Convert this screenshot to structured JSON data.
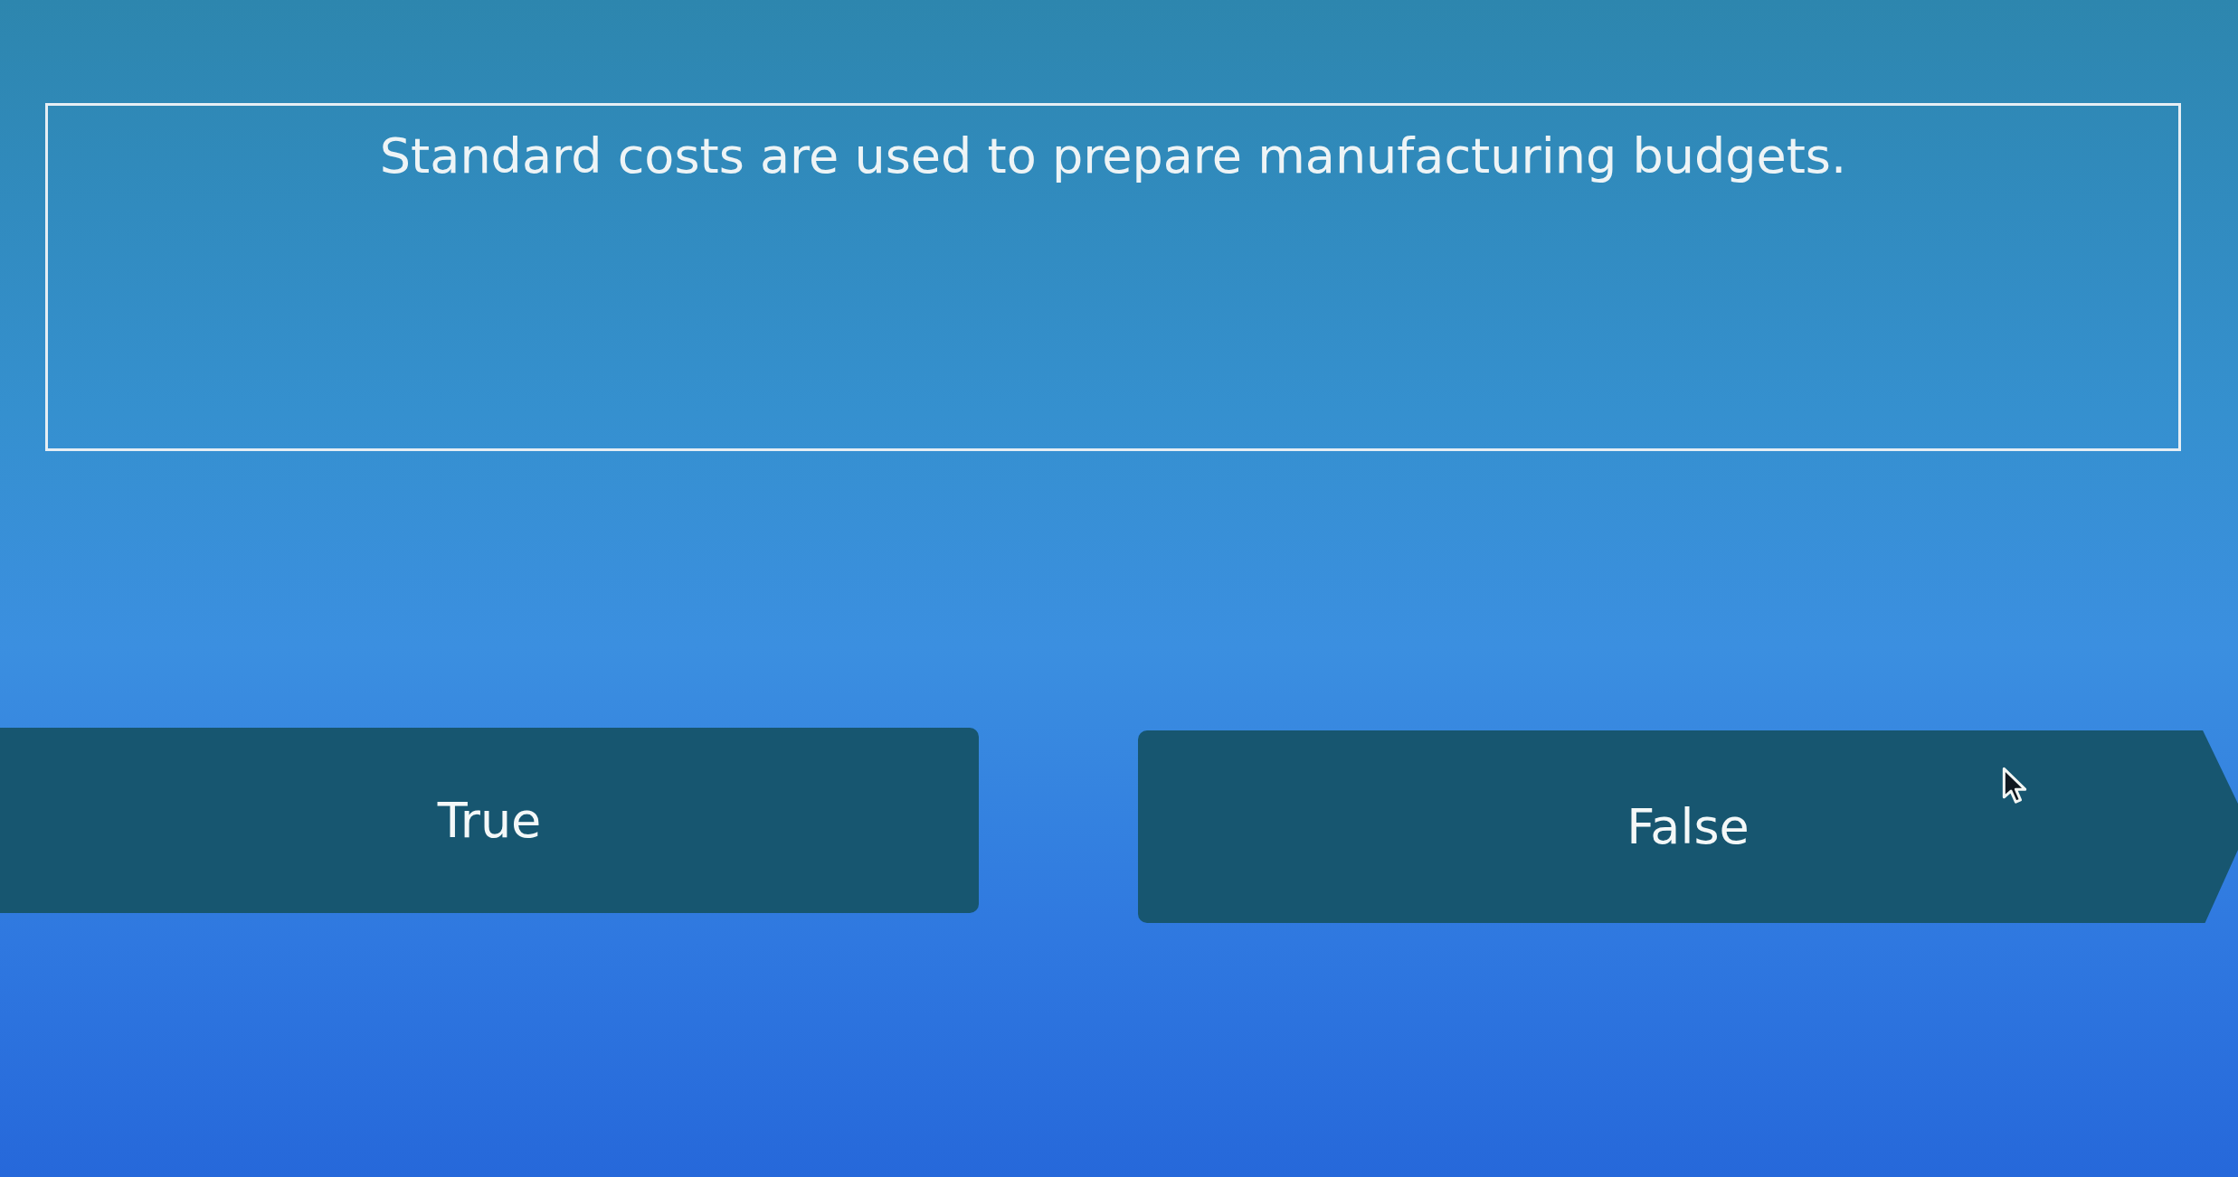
{
  "question": {
    "text": "Standard costs are used to prepare manufacturing budgets."
  },
  "options": [
    {
      "label": "True",
      "kind": "plain"
    },
    {
      "label": "False",
      "kind": "arrow"
    }
  ]
}
